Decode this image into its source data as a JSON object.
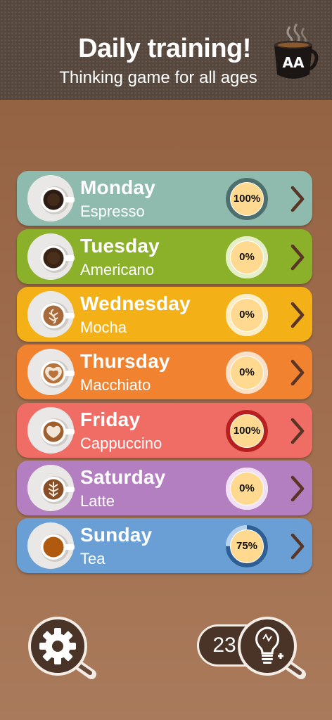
{
  "header": {
    "title": "Daily training!",
    "subtitle": "Thinking game for all ages",
    "logo_icon": "coffee-cup-logo-icon"
  },
  "days": [
    {
      "day": "Monday",
      "drink": "Espresso",
      "progress_label": "100%",
      "progress": 1.0,
      "bg": "#8fbbae",
      "ring_color": "#4d6f6e",
      "ring_track": "#c9dcd6",
      "cup": "espresso"
    },
    {
      "day": "Tuesday",
      "drink": "Americano",
      "progress_label": "0%",
      "progress": 0.0,
      "bg": "#8bb12a",
      "ring_color": "#6f8d1f",
      "ring_track": "#e6f0c8",
      "cup": "americano"
    },
    {
      "day": "Wednesday",
      "drink": "Mocha",
      "progress_label": "0%",
      "progress": 0.0,
      "bg": "#f3b117",
      "ring_color": "#c58c0e",
      "ring_track": "#fbeec7",
      "cup": "mocha"
    },
    {
      "day": "Thursday",
      "drink": "Macchiato",
      "progress_label": "0%",
      "progress": 0.0,
      "bg": "#f08230",
      "ring_color": "#c1621f",
      "ring_track": "#fbe0c8",
      "cup": "macchiato"
    },
    {
      "day": "Friday",
      "drink": "Cappuccino",
      "progress_label": "100%",
      "progress": 1.0,
      "bg": "#f06d66",
      "ring_color": "#b81f1f",
      "ring_track": "#f6c2c0",
      "cup": "cappuccino"
    },
    {
      "day": "Saturday",
      "drink": "Latte",
      "progress_label": "0%",
      "progress": 0.0,
      "bg": "#b47fc1",
      "ring_color": "#8c5a9c",
      "ring_track": "#f2e1f6",
      "cup": "latte"
    },
    {
      "day": "Sunday",
      "drink": "Tea",
      "progress_label": "75%",
      "progress": 0.75,
      "bg": "#6a9fd5",
      "ring_color": "#2d5f95",
      "ring_track": "#b9d3ec",
      "cup": "tea"
    }
  ],
  "footer": {
    "settings_icon": "gear-magnifier-icon",
    "hint_count": "23",
    "hint_icon": "lightbulb-plus-icon"
  },
  "colors": {
    "background": "#9c6a4a",
    "header": "#55473d",
    "progress_fill": "#ffd98f",
    "chevron": "#5a3424"
  }
}
